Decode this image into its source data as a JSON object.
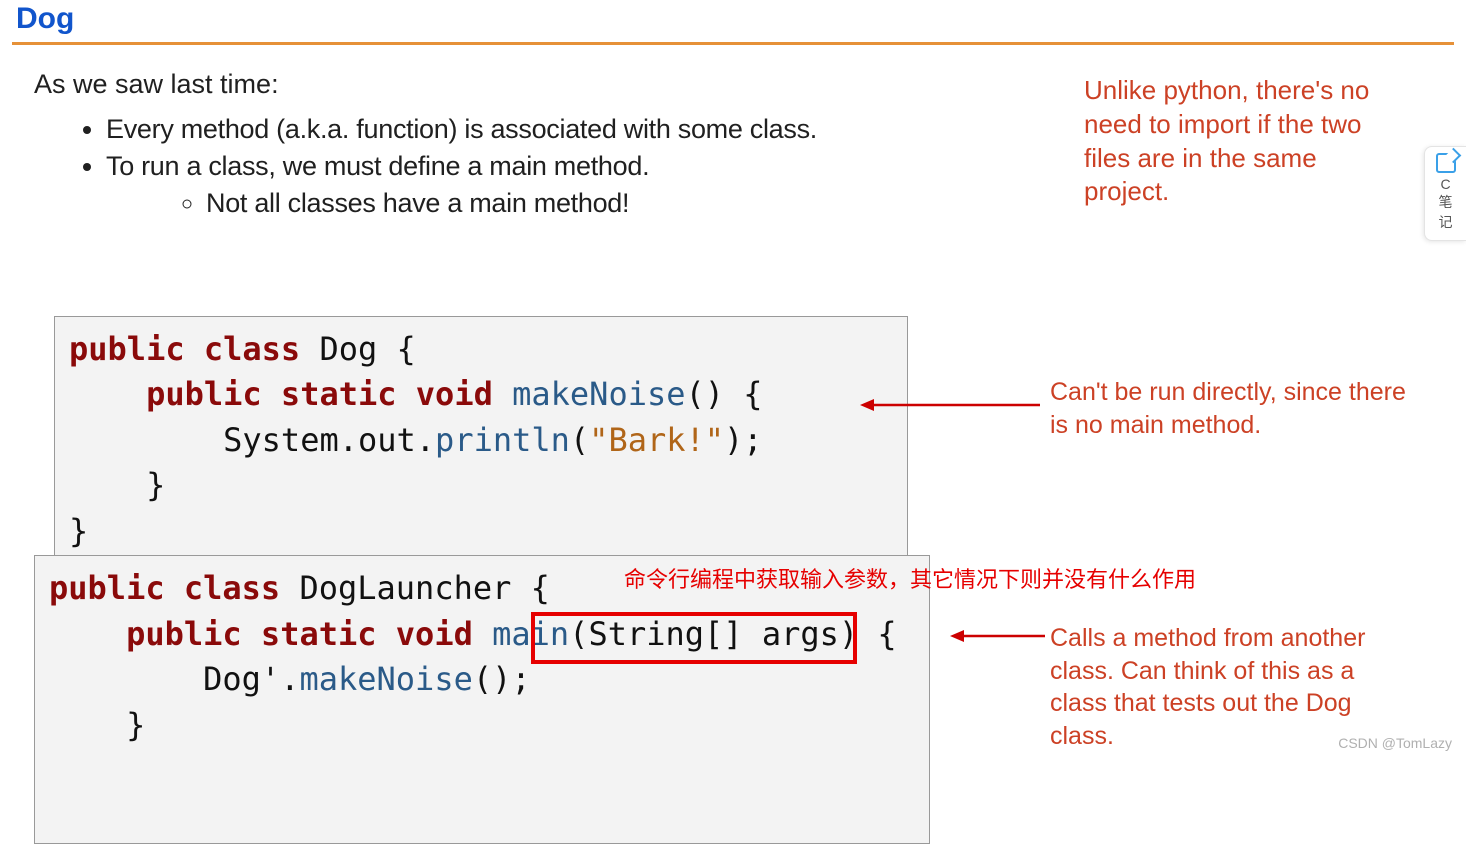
{
  "title": "Dog",
  "intro": "As we saw last time:",
  "bullets": [
    "Every method (a.k.a. function) is associated with some class.",
    "To run a class, we must define a main method."
  ],
  "sub_bullets": [
    "Not all classes have a main method!"
  ],
  "side_note": "Unlike python, there's no need to import if the two files are in the same project.",
  "code1": {
    "l1_kw1": "public",
    "l1_kw2": "class",
    "l1_name": " Dog {",
    "l2_ind": "    ",
    "l2_kw1": "public",
    "l2_kw2": "static",
    "l2_kw3": "void",
    "l2_name": " makeNoise",
    "l2_tail": "() {",
    "l3_ind": "        ",
    "l3_a": "System.out.",
    "l3_m": "println",
    "l3_p1": "(",
    "l3_str": "\"Bark!\"",
    "l3_p2": ");",
    "l4": "    }",
    "l5": "}"
  },
  "code2": {
    "l1_kw1": "public",
    "l1_kw2": "class",
    "l1_name": " DogLauncher {",
    "l2_ind": "    ",
    "l2_kw1": "public",
    "l2_kw2": "static",
    "l2_kw3": "void",
    "l2_name": " main",
    "l2_tail": "(String[] args) {",
    "l3_ind": "        ",
    "l3_a": "Dog'.",
    "l3_m": "makeNoise",
    "l3_p": "();",
    "l4": "    }"
  },
  "annot1": "Can't be run directly, since there is no main method.",
  "annot2": "Calls a method from another class. Can think of this as a class that tests out the Dog class.",
  "chinese": "命令行编程中获取输入参数，其它情况下则并没有什么作用",
  "watermark": "CSDN @TomLazy",
  "tab": {
    "l1": "C",
    "l2": "笔",
    "l3": "记"
  }
}
